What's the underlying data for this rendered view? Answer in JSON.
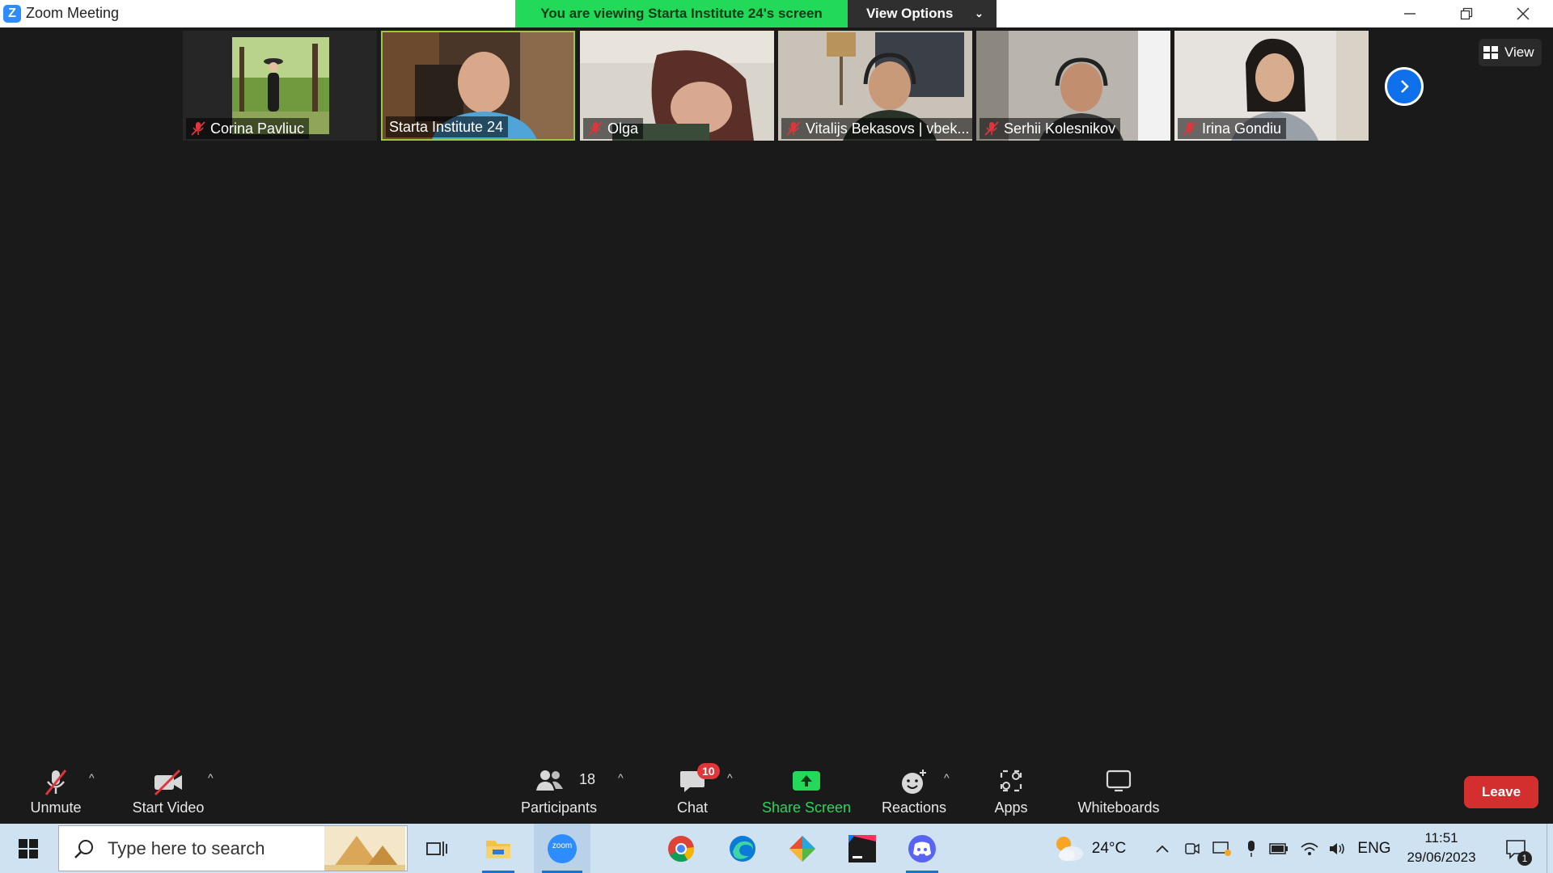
{
  "window": {
    "title": "Zoom Meeting",
    "share_banner": "You are viewing Starta Institute 24's screen",
    "view_options": "View Options"
  },
  "participants": [
    {
      "name": "Corina Pavliuc",
      "muted": true,
      "active_speaker": false
    },
    {
      "name": "Starta Institute 24",
      "muted": false,
      "active_speaker": true
    },
    {
      "name": "Olga",
      "muted": true,
      "active_speaker": false
    },
    {
      "name": "Vitalijs Bekasovs | vbek...",
      "muted": true,
      "active_speaker": false
    },
    {
      "name": "Serhii Kolesnikov",
      "muted": true,
      "active_speaker": false
    },
    {
      "name": "Irina Gondiu",
      "muted": true,
      "active_speaker": false
    }
  ],
  "view_button": "View",
  "toolbar": {
    "unmute": "Unmute",
    "start_video": "Start Video",
    "participants": "Participants",
    "participants_count": "18",
    "chat": "Chat",
    "chat_badge": "10",
    "share_screen": "Share Screen",
    "reactions": "Reactions",
    "apps": "Apps",
    "whiteboards": "Whiteboards",
    "leave": "Leave"
  },
  "taskbar": {
    "search_placeholder": "Type here to search",
    "weather": "24°C",
    "language": "ENG",
    "time": "11:51",
    "date": "29/06/2023",
    "notification_count": "1",
    "zoom_label": "zoom"
  },
  "colors": {
    "banner_green": "#23d959",
    "active_speaker_border": "#9ac83f",
    "leave_red": "#d32f2f",
    "zoom_blue": "#2d8cff",
    "muted_red": "#e0353b"
  }
}
